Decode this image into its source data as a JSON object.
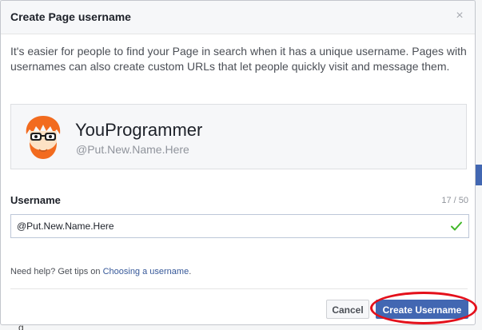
{
  "dialog": {
    "title": "Create Page username",
    "close_glyph": "×",
    "intro": "It's easier for people to find your Page in search when it has a unique username. Pages with usernames can also create custom URLs that let people quickly visit and message them."
  },
  "page_card": {
    "name": "YouProgrammer",
    "handle": "@Put.New.Name.Here",
    "avatar_icon": "cartoon-avatar-icon"
  },
  "username_field": {
    "label": "Username",
    "char_count": "17 / 50",
    "value": "@Put.New.Name.Here",
    "status_icon": "checkmark-icon",
    "status_color": "#42b72a"
  },
  "help": {
    "prefix": "Need help? Get tips on ",
    "link": "Choosing a username",
    "suffix": "."
  },
  "footer": {
    "cancel_label": "Cancel",
    "create_label": "Create Username"
  },
  "colors": {
    "primary": "#4267b2",
    "link": "#365899",
    "highlight": "#e4101b"
  },
  "background_page": {
    "bottom_char": "g"
  }
}
